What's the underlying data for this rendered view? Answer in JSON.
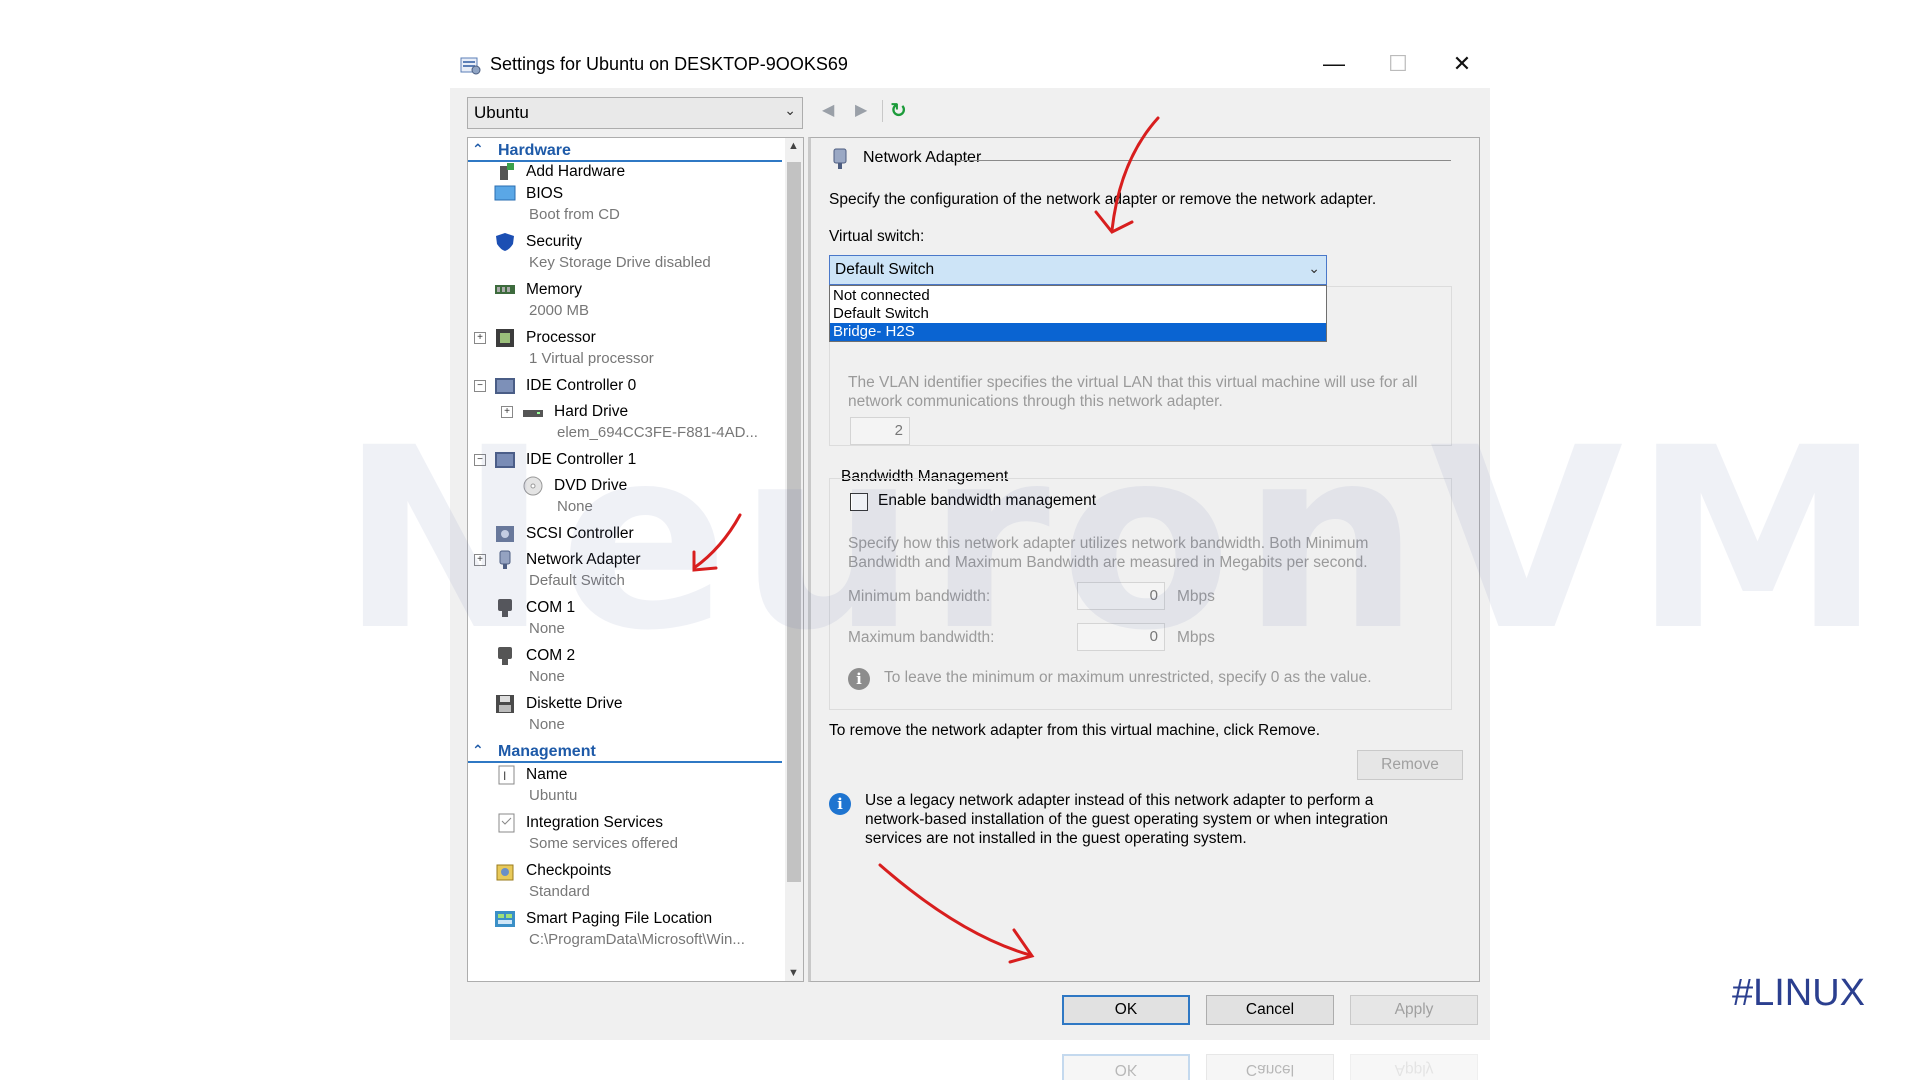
{
  "window": {
    "title": "Settings for Ubuntu on DESKTOP-9OOKS69",
    "minimize": "—",
    "maximize": "☐",
    "close": "✕"
  },
  "toolbar": {
    "vm_selected": "Ubuntu",
    "back": "◀",
    "forward": "▶",
    "refresh": "↻"
  },
  "tree": {
    "hardware_header": "Hardware",
    "management_header": "Management",
    "items": [
      {
        "name": "Add Hardware",
        "sub": ""
      },
      {
        "name": "BIOS",
        "sub": "Boot from CD"
      },
      {
        "name": "Security",
        "sub": "Key Storage Drive disabled"
      },
      {
        "name": "Memory",
        "sub": "2000 MB"
      },
      {
        "name": "Processor",
        "sub": "1 Virtual processor"
      },
      {
        "name": "IDE Controller 0",
        "sub": ""
      },
      {
        "name": "Hard Drive",
        "sub": "elem_694CC3FE-F881-4AD..."
      },
      {
        "name": "IDE Controller 1",
        "sub": ""
      },
      {
        "name": "DVD Drive",
        "sub": "None"
      },
      {
        "name": "SCSI Controller",
        "sub": ""
      },
      {
        "name": "Network Adapter",
        "sub": "Default Switch"
      },
      {
        "name": "COM 1",
        "sub": "None"
      },
      {
        "name": "COM 2",
        "sub": "None"
      },
      {
        "name": "Diskette Drive",
        "sub": "None"
      }
    ],
    "mgmt_items": [
      {
        "name": "Name",
        "sub": "Ubuntu"
      },
      {
        "name": "Integration Services",
        "sub": "Some services offered"
      },
      {
        "name": "Checkpoints",
        "sub": "Standard"
      },
      {
        "name": "Smart Paging File Location",
        "sub": "C:\\ProgramData\\Microsoft\\Win..."
      }
    ]
  },
  "panel": {
    "header": "Network Adapter",
    "description": "Specify the configuration of the network adapter or remove the network adapter.",
    "vswitch_label": "Virtual switch:",
    "vswitch_value": "Default Switch",
    "vswitch_options": [
      "Not connected",
      "Default Switch",
      "Bridge- H2S"
    ],
    "vlan_text_1": "The VLAN identifier specifies the virtual LAN that this virtual machine will use for all",
    "vlan_text_2": "network communications through this network adapter.",
    "vlan_value": "2",
    "bw_title": "Bandwidth Management",
    "bw_checkbox": "Enable bandwidth management",
    "bw_text_1": "Specify how this network adapter utilizes network bandwidth. Both Minimum",
    "bw_text_2": "Bandwidth and Maximum Bandwidth are measured in Megabits per second.",
    "min_label": "Minimum bandwidth:",
    "min_value": "0",
    "max_label": "Maximum bandwidth:",
    "max_value": "0",
    "unit": "Mbps",
    "bw_note": "To leave the minimum or maximum unrestricted, specify 0 as the value.",
    "remove_text": "To remove the network adapter from this virtual machine, click Remove.",
    "remove_button": "Remove",
    "legacy_1": "Use a legacy network adapter instead of this network adapter to perform a",
    "legacy_2": "network-based installation of the guest operating system or when integration",
    "legacy_3": "services are not installed in the guest operating system."
  },
  "footer": {
    "ok": "OK",
    "cancel": "Cancel",
    "apply": "Apply"
  },
  "watermark": "NeuronVM",
  "tag": "#LINUX",
  "colors": {
    "section_blue": "#1e5aa8",
    "selection_blue": "#0a64d2",
    "annotation_red": "#d81e1e"
  }
}
